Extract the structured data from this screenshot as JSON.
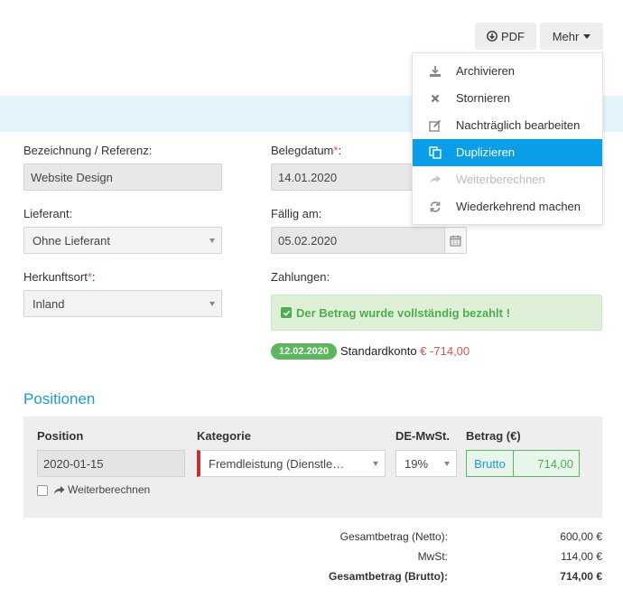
{
  "toolbar": {
    "pdf_label": "PDF",
    "more_label": "Mehr"
  },
  "menu": {
    "items": [
      {
        "label": "Archivieren",
        "icon": "download-icon",
        "state": "normal"
      },
      {
        "label": "Stornieren",
        "icon": "close-icon",
        "state": "normal"
      },
      {
        "label": "Nachträglich bearbeiten",
        "icon": "edit-icon",
        "state": "normal"
      },
      {
        "label": "Duplizieren",
        "icon": "copy-icon",
        "state": "active"
      },
      {
        "label": "Weiterberechnen",
        "icon": "share-icon",
        "state": "disabled"
      },
      {
        "label": "Wiederkehrend machen",
        "icon": "refresh-icon",
        "state": "normal"
      }
    ]
  },
  "form": {
    "bezeichnung_label": "Bezeichnung / Referenz:",
    "bezeichnung_value": "Website Design",
    "belegdatum_label": "Belegdatum",
    "belegdatum_value": "14.01.2020",
    "lieferant_label": "Lieferant:",
    "lieferant_value": "Ohne Lieferant",
    "faellig_label": "Fällig am:",
    "faellig_value": "05.02.2020",
    "herkunft_label": "Herkunftsort",
    "herkunft_value": "Inland",
    "zahlungen_label": "Zahlungen:",
    "required_mark": "*",
    "colon": ":"
  },
  "payment": {
    "alert_text": "Der Betrag wurde vollständig bezahlt !",
    "date": "12.02.2020",
    "account": "Standardkonto",
    "amount": "€ -714,00"
  },
  "positions": {
    "title": "Positionen",
    "headers": {
      "position": "Position",
      "kategorie": "Kategorie",
      "mwst": "DE-MwSt.",
      "betrag": "Betrag (€)"
    },
    "row": {
      "position": "2020-01-15",
      "kategorie": "Fremdleistung (Dienstle…",
      "mwst": "19%",
      "betrag_mode": "Brutto",
      "betrag_value": "714,00"
    },
    "weiterberechnen_label": "Weiterberechnen"
  },
  "totals": {
    "netto_label": "Gesamtbetrag (Netto):",
    "netto_value": "600,00 €",
    "mwst_label": "MwSt:",
    "mwst_value": "114,00 €",
    "brutto_label": "Gesamtbetrag (Brutto):",
    "brutto_value": "714,00 €"
  },
  "colors": {
    "accent_blue": "#0a9ee8",
    "success_green": "#5cb85c",
    "danger_red": "#d9534f",
    "band_blue": "#e3f4fc"
  }
}
